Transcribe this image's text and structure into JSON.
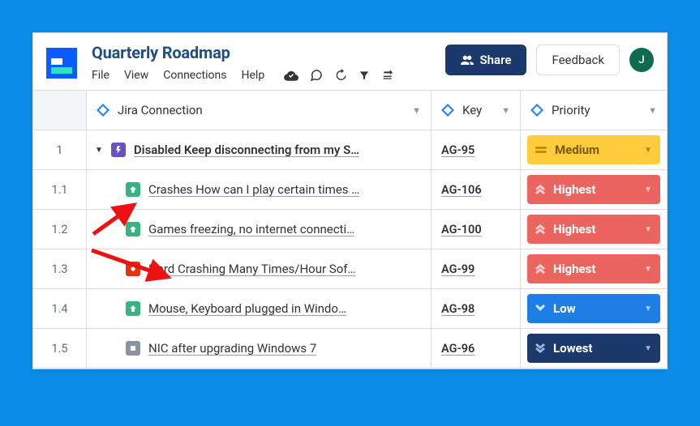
{
  "header": {
    "title": "Quarterly Roadmap",
    "menu": {
      "file": "File",
      "view": "View",
      "connections": "Connections",
      "help": "Help"
    },
    "share_label": "Share",
    "feedback_label": "Feedback",
    "avatar_initial": "J"
  },
  "columns": {
    "summary": "Jira Connection",
    "key": "Key",
    "priority": "Priority"
  },
  "priority_labels": {
    "medium": "Medium",
    "highest": "Highest",
    "low": "Low",
    "lowest": "Lowest"
  },
  "rows": [
    {
      "idx": "1",
      "indent": false,
      "icon": "epic",
      "bold": true,
      "summary": "Disabled Keep disconnecting from my S…",
      "key": "AG-95",
      "priority": "medium"
    },
    {
      "idx": "1.1",
      "indent": true,
      "icon": "up",
      "bold": false,
      "summary": "Crashes How can I play certain times …",
      "key": "AG-106",
      "priority": "highest"
    },
    {
      "idx": "1.2",
      "indent": true,
      "icon": "up",
      "bold": false,
      "summary": "Games freezing, no internet connecti…",
      "key": "AG-100",
      "priority": "highest"
    },
    {
      "idx": "1.3",
      "indent": true,
      "icon": "bug",
      "bold": false,
      "summary": "Hard Crashing Many Times/Hour Sof…",
      "key": "AG-99",
      "priority": "highest"
    },
    {
      "idx": "1.4",
      "indent": true,
      "icon": "up",
      "bold": false,
      "summary": "Mouse, Keyboard plugged in Windo…",
      "key": "AG-98",
      "priority": "low"
    },
    {
      "idx": "1.5",
      "indent": true,
      "icon": "grey",
      "bold": false,
      "summary": "NIC after upgrading Windows 7",
      "key": "AG-96",
      "priority": "lowest"
    }
  ]
}
